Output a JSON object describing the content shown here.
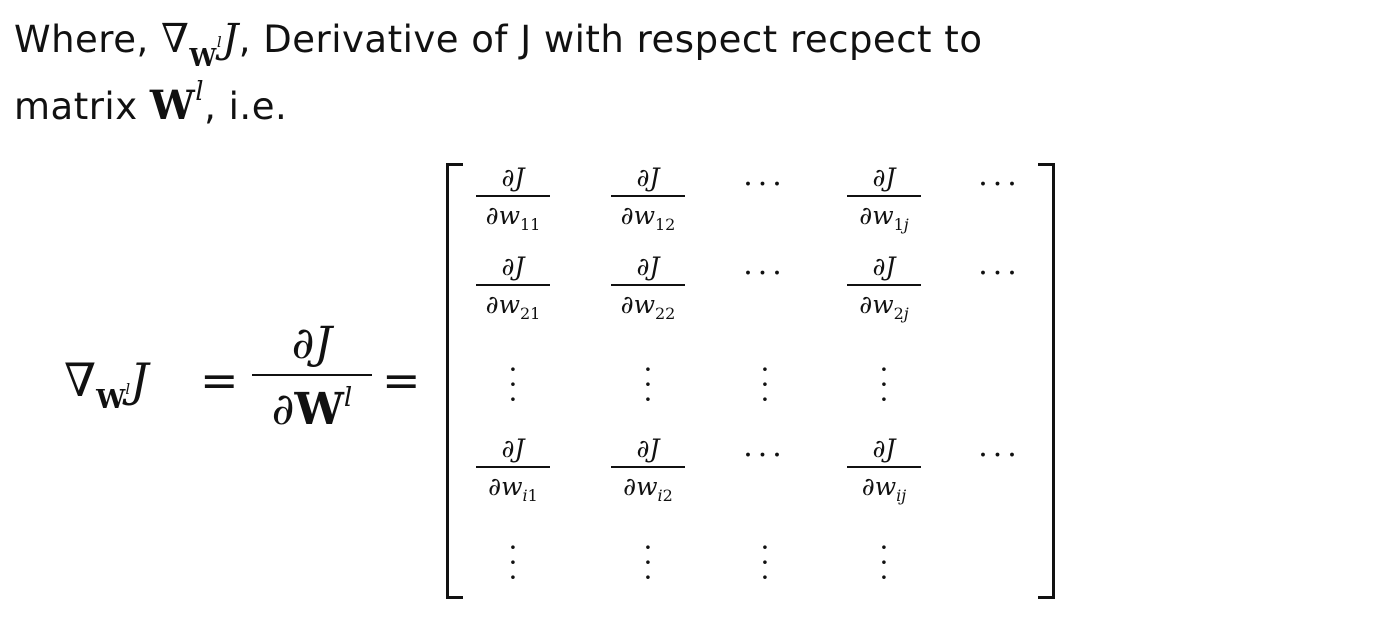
{
  "intro": {
    "line1_prefix": "Where, ",
    "nabla": "∇",
    "nabla_sub": "W",
    "nabla_sub_sup": "l",
    "J": "J",
    "line1_suffix": ", Derivative of J with respect recpect to",
    "line2_prefix": "matrix ",
    "W": "W",
    "W_sup": "l",
    "line2_suffix": ", i.e."
  },
  "equation": {
    "nabla": "∇",
    "sub_W": "W",
    "sub_sup": "l",
    "J": "J",
    "equals": "=",
    "frac_num": "∂J",
    "frac_den_partial": "∂",
    "frac_den_W": "W",
    "frac_den_sup": "l"
  },
  "matrix": {
    "numerator": "∂J",
    "den_prefix": "∂w",
    "rows": [
      {
        "kind": "frac",
        "subs": [
          "11",
          "12",
          null,
          "1j",
          null
        ]
      },
      {
        "kind": "frac",
        "subs": [
          "21",
          "22",
          null,
          "2j",
          null
        ]
      },
      {
        "kind": "vdots"
      },
      {
        "kind": "frac",
        "subs": [
          "i1",
          "i2",
          null,
          "ij",
          null
        ]
      },
      {
        "kind": "vdots"
      }
    ],
    "hdots": "⋯",
    "vdots": "⋮"
  }
}
